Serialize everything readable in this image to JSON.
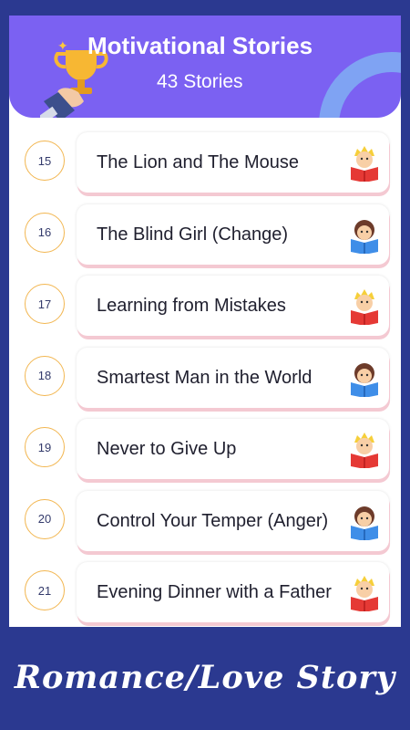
{
  "header": {
    "title": "Motivational Stories",
    "subtitle": "43 Stories",
    "icon": "trophy-icon",
    "colors": {
      "background": "#7b61f2",
      "accent_arc": "#7fa3f3"
    }
  },
  "stories": [
    {
      "number": "15",
      "title": "The Lion and The Mouse",
      "icon": "boy-reading-icon"
    },
    {
      "number": "16",
      "title": "The Blind Girl (Change)",
      "icon": "girl-reading-icon"
    },
    {
      "number": "17",
      "title": "Learning from Mistakes",
      "icon": "boy-reading-icon"
    },
    {
      "number": "18",
      "title": "Smartest Man in the World",
      "icon": "girl-reading-icon"
    },
    {
      "number": "19",
      "title": "Never to Give Up",
      "icon": "boy-reading-icon"
    },
    {
      "number": "20",
      "title": "Control Your Temper (Anger)",
      "icon": "girl-reading-icon"
    },
    {
      "number": "21",
      "title": "Evening Dinner with a Father",
      "icon": "boy-reading-icon"
    }
  ],
  "banner": {
    "text": "Romance/Love Story"
  },
  "colors": {
    "page_background": "#2b3990",
    "number_ring": "#f2b650",
    "card_shadow": "#f4c9d2"
  }
}
